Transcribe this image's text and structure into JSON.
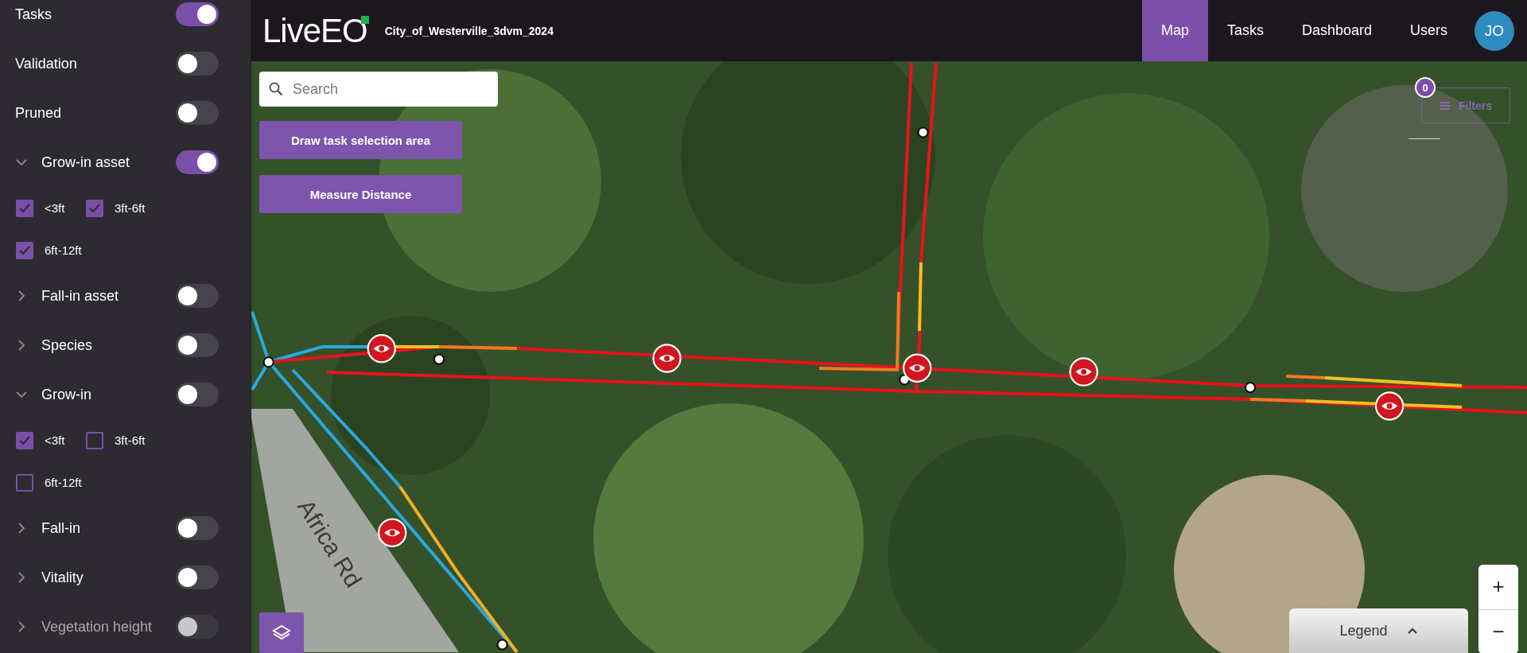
{
  "sidebar": {
    "items": [
      {
        "kind": "toggle",
        "label": "Tasks",
        "on": true,
        "disabled": false
      },
      {
        "kind": "toggle",
        "label": "Validation",
        "on": false,
        "disabled": false
      },
      {
        "kind": "toggle",
        "label": "Pruned",
        "on": false,
        "disabled": false
      },
      {
        "kind": "group",
        "label": "Grow-in asset",
        "on": true,
        "disabled": false,
        "expanded": true,
        "options": [
          {
            "label": "<3ft",
            "checked": true
          },
          {
            "label": "3ft-6ft",
            "checked": true
          },
          {
            "label": "6ft-12ft",
            "checked": true
          }
        ]
      },
      {
        "kind": "group",
        "label": "Fall-in asset",
        "on": false,
        "disabled": false,
        "expanded": false
      },
      {
        "kind": "group",
        "label": "Species",
        "on": false,
        "disabled": false,
        "expanded": false
      },
      {
        "kind": "group",
        "label": "Grow-in",
        "on": false,
        "disabled": false,
        "expanded": true,
        "options": [
          {
            "label": "<3ft",
            "checked": true
          },
          {
            "label": "3ft-6ft",
            "checked": false
          },
          {
            "label": "6ft-12ft",
            "checked": false
          }
        ]
      },
      {
        "kind": "group",
        "label": "Fall-in",
        "on": false,
        "disabled": false,
        "expanded": false
      },
      {
        "kind": "group",
        "label": "Vitality",
        "on": false,
        "disabled": false,
        "expanded": false
      },
      {
        "kind": "group",
        "label": "Vegetation height",
        "on": false,
        "disabled": true,
        "expanded": false
      }
    ]
  },
  "header": {
    "logo": "LiveEO",
    "project": "City_of_Westerville_3dvm_2024",
    "nav": [
      {
        "label": "Map",
        "selected": true
      },
      {
        "label": "Tasks",
        "selected": false
      },
      {
        "label": "Dashboard",
        "selected": false
      },
      {
        "label": "Users",
        "selected": false
      }
    ],
    "avatar": "JO"
  },
  "map": {
    "search": {
      "placeholder": "Search"
    },
    "buttons": [
      "Draw task selection area",
      "Measure Distance"
    ],
    "filters": {
      "label": "Filters",
      "count": "0"
    },
    "road_label": "Africa Rd",
    "legend": {
      "label": "Legend"
    },
    "zoom": {
      "in": "+",
      "out": "−"
    }
  }
}
